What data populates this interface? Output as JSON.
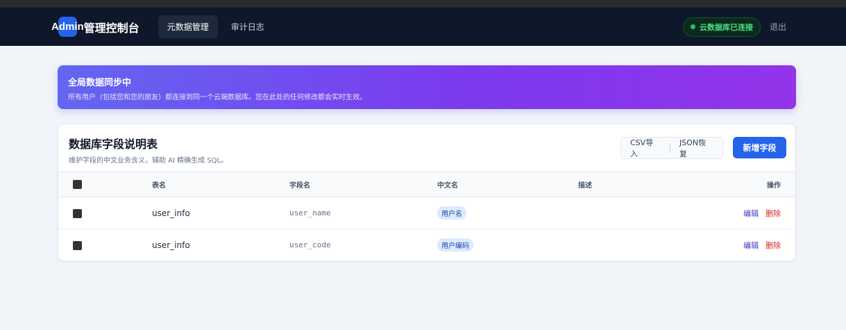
{
  "header": {
    "brand_admin": "Admin",
    "brand_title": "管理控制台",
    "tabs": [
      {
        "label": "元数据管理",
        "active": true
      },
      {
        "label": "审计日志",
        "active": false
      }
    ],
    "status": "云数据库已连接",
    "logout": "退出"
  },
  "banner": {
    "title": "全局数据同步中",
    "description": "所有用户（包括您和您的朋友）都连接到同一个云端数据库。您在此处的任何修改都会实时生效。"
  },
  "card": {
    "title": "数据库字段说明表",
    "subtitle": "维护字段的中文业务含义，辅助 AI 精确生成 SQL。",
    "buttons": {
      "csv_import": "CSV导入",
      "json_restore": "JSON恢复",
      "add_field": "新增字段"
    },
    "columns": [
      "表名",
      "字段名",
      "中文名",
      "描述",
      "操作"
    ],
    "rows": [
      {
        "table": "user_info",
        "field": "user_name",
        "cn_name": "用户名",
        "desc": "",
        "edit": "编辑",
        "delete": "删除"
      },
      {
        "table": "user_info",
        "field": "user_code",
        "cn_name": "用户编码",
        "desc": "",
        "edit": "编辑",
        "delete": "删除"
      }
    ]
  },
  "colors": {
    "navbar_bg": "#0f172a",
    "primary": "#2563eb",
    "banner_gradient_start": "#6366f1",
    "banner_gradient_end": "#9333ea",
    "status_green": "#4ade80",
    "delete_red": "#dc2626"
  }
}
